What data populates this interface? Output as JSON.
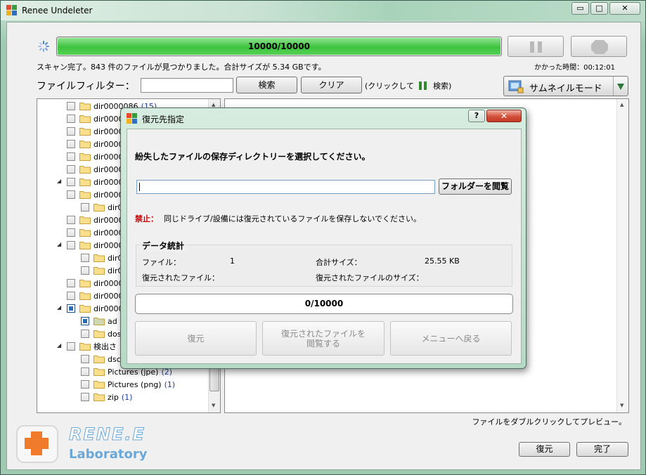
{
  "window": {
    "title": "Renee Undeleter",
    "minimize": "▭",
    "maximize": "□",
    "close": "✕"
  },
  "scan": {
    "progress_text": "10000/10000",
    "progress_fraction": 1.0,
    "status": "スキャン完了。843 件のファイルが見つかりました。合計サイズが 5.34 GBです。",
    "elapsed": "かかった時間：00:12:01"
  },
  "filter": {
    "label": "ファイルフィルター：",
    "search_button": "検索",
    "clear_button": "クリア",
    "hint_before": "(クリックして",
    "hint_after": "検索)",
    "thumbnail_mode": "サムネイルモード"
  },
  "tree": {
    "items": [
      {
        "label": "dir0000086",
        "count": "(15)"
      },
      {
        "label": "dir0000",
        "count": ""
      },
      {
        "label": "dir0000",
        "count": ""
      },
      {
        "label": "dir0000",
        "count": ""
      },
      {
        "label": "dir0000",
        "count": ""
      },
      {
        "label": "dir0000",
        "count": ""
      },
      {
        "label": "dir0000",
        "count": ""
      },
      {
        "label": "dir0000",
        "count": ""
      },
      {
        "label": "dir0",
        "count": ""
      },
      {
        "label": "dir0000",
        "count": ""
      },
      {
        "label": "dir0000",
        "count": ""
      },
      {
        "label": "dir0000",
        "count": ""
      },
      {
        "label": "dir0",
        "count": ""
      },
      {
        "label": "dir0",
        "count": ""
      },
      {
        "label": "dir0000",
        "count": ""
      },
      {
        "label": "dir0000",
        "count": ""
      },
      {
        "label": "dir0000",
        "count": ""
      },
      {
        "label": "ad (",
        "count": ""
      },
      {
        "label": "dos",
        "count": ""
      },
      {
        "label": "検出さ",
        "count": ""
      },
      {
        "label": "dsc",
        "count": ""
      },
      {
        "label": "Pictures (jpe)",
        "count": "(2)"
      },
      {
        "label": "Pictures (png)",
        "count": "(1)"
      },
      {
        "label": "zip",
        "count": "(1)"
      }
    ]
  },
  "preview_hint": "ファイルをダブルクリックしてプレビュー。",
  "brand": {
    "name": "RENE.E",
    "sub": "Laboratory"
  },
  "footer": {
    "recover_button": "復元",
    "done_button": "完了"
  },
  "dialog": {
    "title": "復元先指定",
    "help": "?",
    "close": "✕",
    "prompt": "紛失したファイルの保存ディレクトリーを選択してください。",
    "path_value": "",
    "browse_button": "フォルダーを閲覧",
    "warning_label": "禁止：",
    "warning_text": "同じドライブ/設備には復元されているファイルを保存しないでください。",
    "stats_title": "データ統計",
    "files_label": "ファイル：",
    "files_value": "1",
    "total_size_label": "合計サイズ：",
    "total_size_value": "25.55 KB",
    "recovered_label": "復元されたファイル：",
    "recovered_value": "",
    "recovered_size_label": "復元されたファイルのサイズ：",
    "recovered_size_value": "",
    "progress_text": "0/10000",
    "recover_button": "復元",
    "browse_recovered_button": "復元されたファイルを閲覧する",
    "back_menu_button": "メニューへ戻る"
  },
  "colors": {
    "progress_green": "#3ec43e",
    "warning_red": "#cc0000",
    "count_blue": "#1c3fa0",
    "brand_orange": "#f07b2a",
    "brand_blue": "#6aa8d8"
  }
}
